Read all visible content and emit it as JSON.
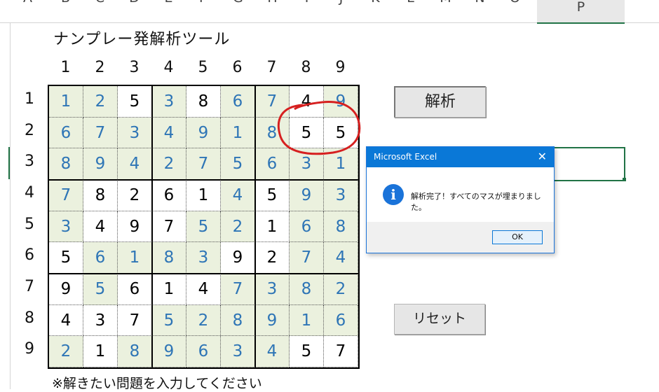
{
  "sheet": {
    "column_letters": [
      "A",
      "B",
      "C",
      "D",
      "E",
      "F",
      "G",
      "H",
      "I",
      "J",
      "K",
      "L",
      "M",
      "N",
      "O",
      "P"
    ],
    "title": "ナンプレー発解析ツール",
    "note": "※解きたい問題を入力してください"
  },
  "grid": {
    "col_labels": [
      "1",
      "2",
      "3",
      "4",
      "5",
      "6",
      "7",
      "8",
      "9"
    ],
    "row_labels": [
      "1",
      "2",
      "3",
      "4",
      "5",
      "6",
      "7",
      "8",
      "9"
    ],
    "values": [
      [
        "1",
        "2",
        "5",
        "3",
        "8",
        "6",
        "7",
        "4",
        "9"
      ],
      [
        "6",
        "7",
        "3",
        "4",
        "9",
        "1",
        "8",
        "5",
        "5"
      ],
      [
        "8",
        "9",
        "4",
        "2",
        "7",
        "5",
        "6",
        "3",
        "1"
      ],
      [
        "7",
        "8",
        "2",
        "6",
        "1",
        "4",
        "5",
        "9",
        "3"
      ],
      [
        "3",
        "4",
        "9",
        "7",
        "5",
        "2",
        "1",
        "6",
        "8"
      ],
      [
        "5",
        "6",
        "1",
        "8",
        "3",
        "9",
        "2",
        "7",
        "4"
      ],
      [
        "9",
        "5",
        "6",
        "1",
        "4",
        "7",
        "3",
        "8",
        "2"
      ],
      [
        "4",
        "3",
        "7",
        "5",
        "2",
        "8",
        "9",
        "1",
        "6"
      ],
      [
        "2",
        "1",
        "8",
        "9",
        "6",
        "3",
        "4",
        "5",
        "7"
      ]
    ],
    "solved_mask": [
      [
        1,
        1,
        0,
        1,
        0,
        1,
        1,
        0,
        1
      ],
      [
        1,
        1,
        1,
        1,
        1,
        1,
        1,
        0,
        0
      ],
      [
        1,
        1,
        1,
        1,
        1,
        1,
        1,
        1,
        1
      ],
      [
        1,
        0,
        0,
        0,
        0,
        1,
        0,
        1,
        1
      ],
      [
        1,
        0,
        0,
        0,
        1,
        1,
        0,
        1,
        1
      ],
      [
        0,
        1,
        1,
        1,
        1,
        0,
        0,
        1,
        1
      ],
      [
        0,
        1,
        0,
        0,
        0,
        1,
        1,
        1,
        1
      ],
      [
        0,
        0,
        0,
        1,
        1,
        1,
        1,
        1,
        1
      ],
      [
        1,
        0,
        1,
        1,
        1,
        1,
        1,
        0,
        0
      ]
    ],
    "colors": {
      "solved_text": "#2e75b6",
      "solved_bg": "#ebf1de",
      "given_text": "#000000"
    }
  },
  "buttons": {
    "analyze_label": "解析",
    "reset_label": "リセット"
  },
  "dialog": {
    "title": "Microsoft Excel",
    "close_glyph": "✕",
    "icon_glyph": "i",
    "message": "解析完了！すべてのマスが埋まりました。",
    "ok_label": "OK"
  },
  "annotation": {
    "color": "#d62020"
  }
}
